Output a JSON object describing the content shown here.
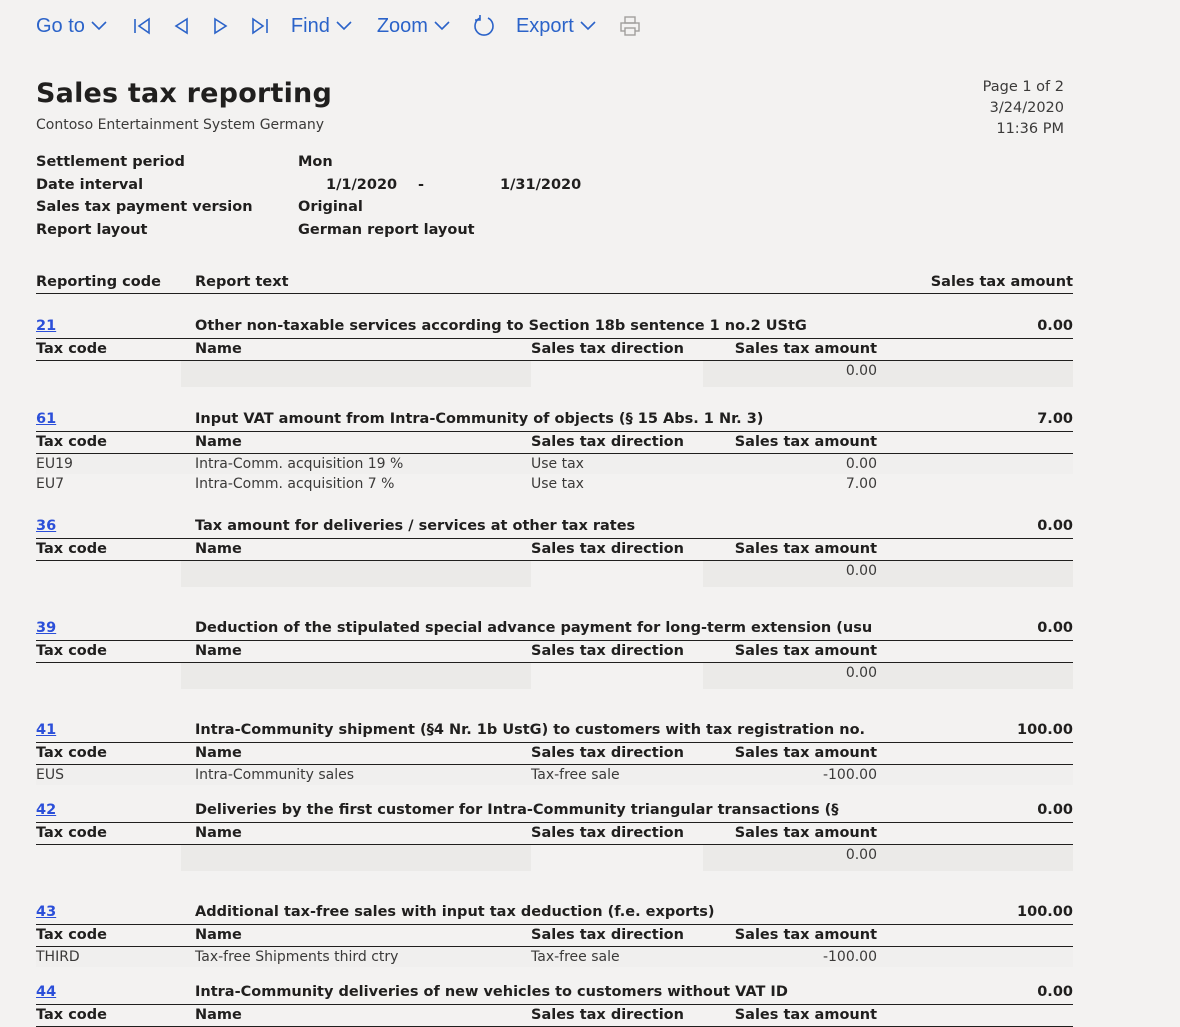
{
  "toolbar": {
    "goto": "Go to",
    "find": "Find",
    "zoom": "Zoom",
    "export": "Export",
    "icons": [
      "first-page-icon",
      "previous-page-icon",
      "next-page-icon",
      "last-page-icon",
      "refresh-icon",
      "print-icon"
    ]
  },
  "report": {
    "title": "Sales tax reporting",
    "company": "Contoso Entertainment System Germany",
    "page": "Page 1 of 2",
    "date": "3/24/2020",
    "time": "11:36 PM",
    "params": {
      "settlement_label": "Settlement period",
      "settlement_value": "Mon",
      "interval_label": "Date interval",
      "interval_from": "1/1/2020",
      "interval_dash": "-",
      "interval_to": "1/31/2020",
      "version_label": "Sales tax payment version",
      "version_value": "Original",
      "layout_label": "Report layout",
      "layout_value": "German report layout"
    },
    "columns": {
      "reporting_code": "Reporting code",
      "report_text": "Report text",
      "sales_tax_amount": "Sales tax amount"
    },
    "sub_columns": {
      "tax_code": "Tax code",
      "name": "Name",
      "direction": "Sales tax direction",
      "amount": "Sales tax amount"
    },
    "sections": [
      {
        "code": "21",
        "text": "Other non-taxable services according to Section 18b sentence 1 no.2 UStG",
        "amount": "0.00",
        "lines": [
          {
            "tax_code": "",
            "name": "",
            "direction": "",
            "amount": "0.00"
          }
        ]
      },
      {
        "code": "61",
        "text": "Input VAT amount from Intra-Community of objects (§ 15 Abs. 1 Nr. 3)",
        "amount": "7.00",
        "lines": [
          {
            "tax_code": "EU19",
            "name": "Intra-Comm. acquisition 19 %",
            "direction": "Use tax",
            "amount": "0.00"
          },
          {
            "tax_code": "EU7",
            "name": "Intra-Comm. acquisition 7 %",
            "direction": "Use tax",
            "amount": "7.00"
          }
        ]
      },
      {
        "code": "36",
        "text": "Tax amount for deliveries / services at other tax rates",
        "amount": "0.00",
        "lines": [
          {
            "tax_code": "",
            "name": "",
            "direction": "",
            "amount": "0.00"
          }
        ]
      },
      {
        "code": "39",
        "text": "Deduction of the stipulated special advance payment for long-term extension (usu",
        "amount": "0.00",
        "lines": [
          {
            "tax_code": "",
            "name": "",
            "direction": "",
            "amount": "0.00"
          }
        ]
      },
      {
        "code": "41",
        "text": "Intra-Community shipment (§4 Nr. 1b UstG) to customers with tax registration no.",
        "amount": "100.00",
        "lines": [
          {
            "tax_code": "EUS",
            "name": "Intra-Community sales",
            "direction": "Tax-free sale",
            "amount": "-100.00"
          }
        ]
      },
      {
        "code": "42",
        "text": "Deliveries by the first customer for Intra-Community triangular transactions (§",
        "amount": "0.00",
        "lines": [
          {
            "tax_code": "",
            "name": "",
            "direction": "",
            "amount": "0.00"
          }
        ]
      },
      {
        "code": "43",
        "text": "Additional tax-free sales with input tax deduction (f.e. exports)",
        "amount": "100.00",
        "lines": [
          {
            "tax_code": "THIRD",
            "name": "Tax-free Shipments third ctry",
            "direction": "Tax-free sale",
            "amount": "-100.00"
          }
        ]
      },
      {
        "code": "44",
        "text": "Intra-Community deliveries of new vehicles to customers without VAT ID",
        "amount": "0.00",
        "lines": []
      }
    ]
  }
}
